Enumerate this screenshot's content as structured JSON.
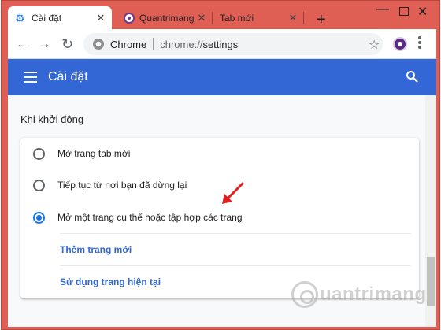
{
  "window": {
    "frame_color": "#e05f55",
    "accent": "#3367d6"
  },
  "tabs": [
    {
      "title": "Cài đặt",
      "icon": "gear-icon",
      "close": "✕",
      "active": true
    },
    {
      "title": "Quantrimang.c",
      "icon": "quantrimang-icon",
      "close": "✕",
      "active": false
    },
    {
      "title": "Tab mới",
      "icon": "",
      "close": "✕",
      "active": false
    }
  ],
  "tabstrip": {
    "new_tab": "+"
  },
  "window_controls": {
    "minimize": "—",
    "close": "✕"
  },
  "toolbar": {
    "back": "←",
    "forward": "→",
    "reload": "↻",
    "site_name": "Chrome",
    "url_scheme": "chrome://",
    "url_path": "settings",
    "star": "☆"
  },
  "header": {
    "title": "Cài đặt"
  },
  "startup": {
    "section_title": "Khi khởi động",
    "options": [
      {
        "label": "Mở trang tab mới",
        "checked": false
      },
      {
        "label": "Tiếp tục từ nơi bạn đã dừng lại",
        "checked": false
      },
      {
        "label": "Mở một trang cụ thể hoặc tập hợp các trang",
        "checked": true
      }
    ],
    "links": [
      {
        "label": "Thêm trang mới"
      },
      {
        "label": "Sử dụng trang hiện tại"
      }
    ]
  },
  "watermark": {
    "text": "uantrimang"
  }
}
